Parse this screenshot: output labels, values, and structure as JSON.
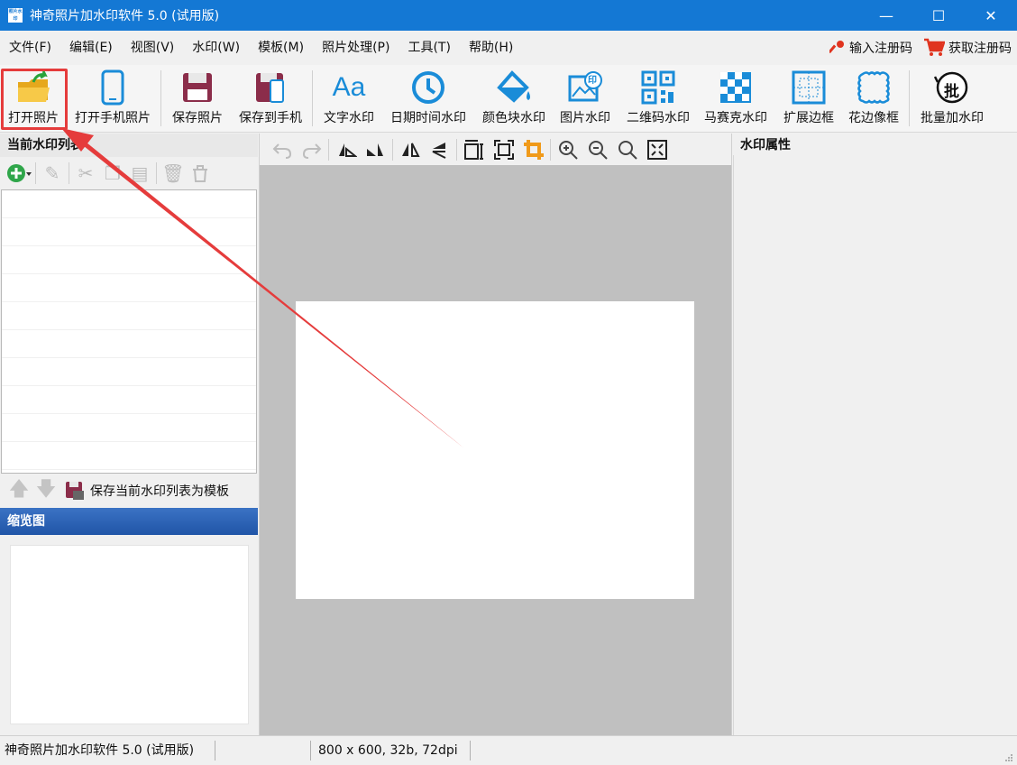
{
  "window": {
    "icon_text": "照片水印",
    "title": "神奇照片加水印软件 5.0 (试用版)",
    "controls": {
      "minimize": "—",
      "maximize": "☐",
      "close": "✕"
    }
  },
  "menu": {
    "items": [
      "文件(F)",
      "编辑(E)",
      "视图(V)",
      "水印(W)",
      "模板(M)",
      "照片处理(P)",
      "工具(T)",
      "帮助(H)"
    ],
    "enter_code": "输入注册码",
    "get_code": "获取注册码"
  },
  "toolbar": {
    "buttons": [
      {
        "label": "打开照片",
        "icon": "open-folder-icon"
      },
      {
        "label": "打开手机照片",
        "icon": "phone-icon"
      },
      {
        "label": "保存照片",
        "icon": "save-icon"
      },
      {
        "label": "保存到手机",
        "icon": "save-to-phone-icon"
      },
      {
        "label": "文字水印",
        "icon": "text-aa-icon",
        "glyph": "Aa"
      },
      {
        "label": "日期时间水印",
        "icon": "clock-icon"
      },
      {
        "label": "颜色块水印",
        "icon": "paint-bucket-icon"
      },
      {
        "label": "图片水印",
        "icon": "image-stamp-icon",
        "glyph": "印"
      },
      {
        "label": "二维码水印",
        "icon": "qr-code-icon"
      },
      {
        "label": "马赛克水印",
        "icon": "mosaic-icon"
      },
      {
        "label": "扩展边框",
        "icon": "extend-border-icon"
      },
      {
        "label": "花边像框",
        "icon": "lace-frame-icon"
      },
      {
        "label": "批量加水印",
        "icon": "batch-icon",
        "glyph": "批"
      }
    ]
  },
  "watermark_list": {
    "title": "当前水印列表",
    "rows": [
      "",
      "",
      "",
      "",
      "",
      "",
      "",
      "",
      "",
      ""
    ],
    "save_template": "保存当前水印列表为模板"
  },
  "thumbnail": {
    "title": "缩览图"
  },
  "properties": {
    "title": "水印属性"
  },
  "status": {
    "app": "神奇照片加水印软件 5.0 (试用版)",
    "image_info": "800 x 600, 32b, 72dpi"
  },
  "colors": {
    "title_bar": "#1478d4",
    "accent_blue": "#1a8cd8",
    "highlight_red": "#e53c3c",
    "canvas_gray": "#c0c0c0"
  }
}
